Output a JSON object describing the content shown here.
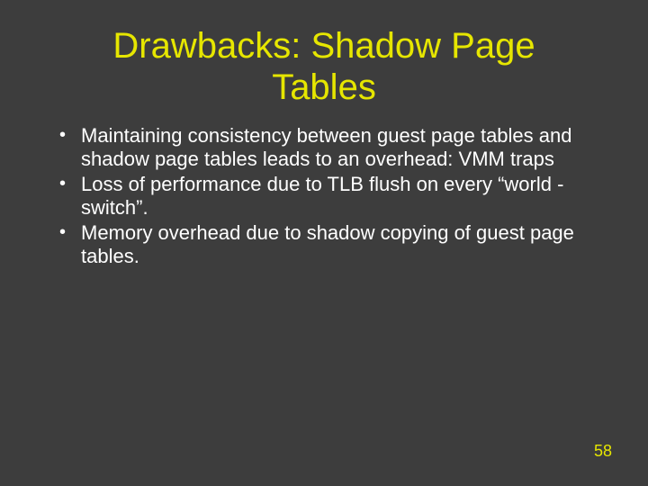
{
  "slide": {
    "title_line1": "Drawbacks: Shadow Page",
    "title_line2": "Tables",
    "bullets": [
      "Maintaining consistency between guest page tables and shadow page tables leads to an overhead: VMM traps",
      "Loss of performance due to TLB flush on every “world -switch”.",
      "Memory overhead due to shadow copying of guest page tables."
    ],
    "page_number": "58"
  }
}
